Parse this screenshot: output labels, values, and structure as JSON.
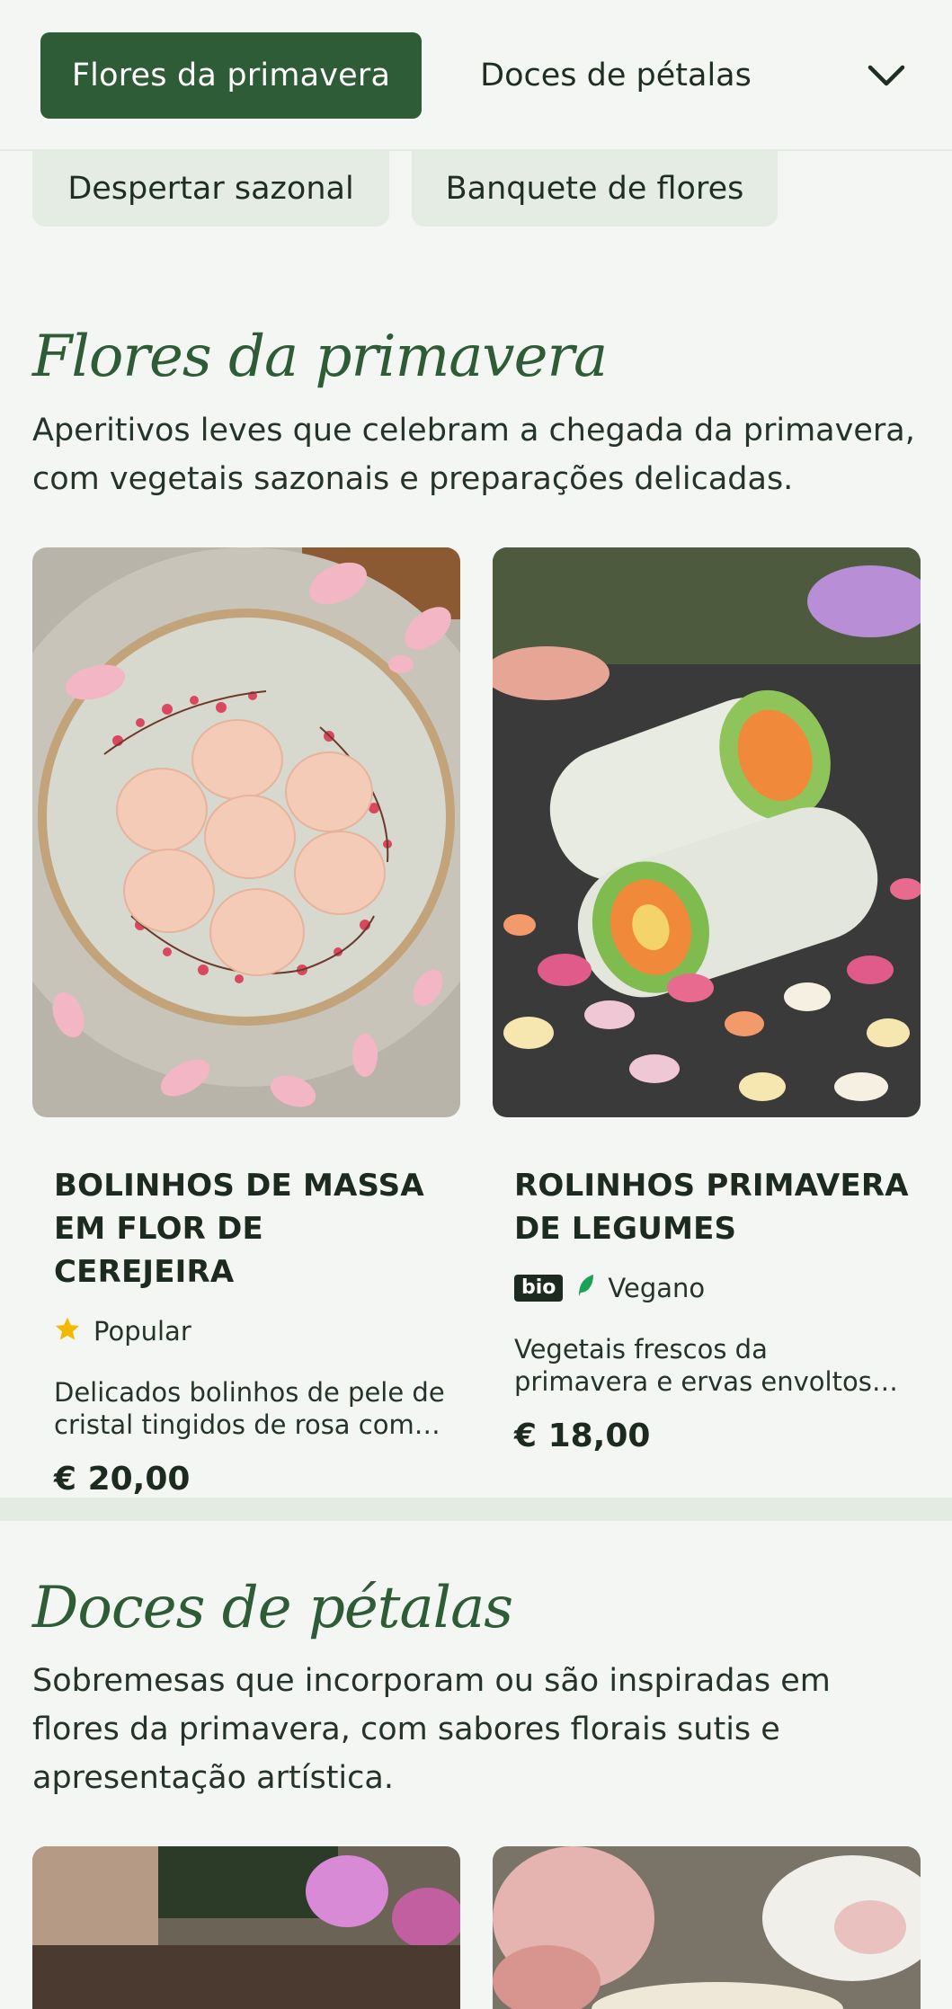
{
  "nav": {
    "active_chip": "Flores da primavera",
    "chip_2": "Doces de pétalas",
    "chip_3": "Despertar sazonal",
    "chip_4": "Banquete de flores",
    "expand_icon": "chevron-down-icon"
  },
  "sections": [
    {
      "title": "Flores da primavera",
      "description": "Aperitivos leves que celebram a chegada da primavera, com vegetais sazonais e preparações delicadas.",
      "items": [
        {
          "name": "BOLINHOS DE MASSA EM FLOR DE CEREJEIRA",
          "tag_icon": "star-icon",
          "tag": "Popular",
          "description": "Delicados bolinhos de pele de cristal tingidos de rosa com recheio primaveril",
          "price": "€ 20,00"
        },
        {
          "name": "ROLINHOS PRIMAVERA DE LEGUMES",
          "badge": "bio",
          "tag_icon": "leaf-icon",
          "tag": "Vegano",
          "description": "Vegetais frescos da primavera e ervas envoltos em papel de arroz",
          "price": "€ 18,00"
        }
      ]
    },
    {
      "title": "Doces de pétalas",
      "description": "Sobremesas que incorporam ou são inspiradas em flores da primavera, com sabores florais sutis e apresentação artística."
    }
  ],
  "colors": {
    "brand_green": "#2d5c36",
    "background": "#f3f6f2",
    "chip_soft": "#e5ece4",
    "star": "#f5b800",
    "leaf": "#1aa356"
  }
}
